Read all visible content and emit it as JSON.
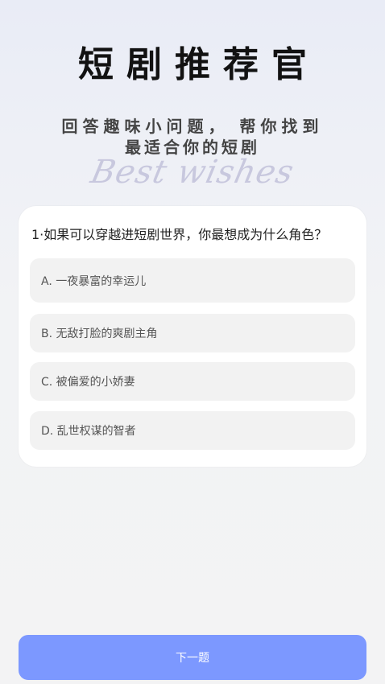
{
  "header": {
    "title": "短剧推荐官",
    "subtitle_line1": "回答趣味小问题， 帮你找到",
    "subtitle_line2": "最适合你的短剧",
    "script_text": "Best wishes"
  },
  "quiz": {
    "question": "1·如果可以穿越进短剧世界，你最想成为什么角色？",
    "options": [
      {
        "label": "A. 一夜暴富的幸运儿"
      },
      {
        "label": "B. 无敌打脸的爽剧主角"
      },
      {
        "label": "C. 被偏爱的小娇妻"
      },
      {
        "label": "D. 乱世权谋的智者"
      }
    ]
  },
  "footer": {
    "next_label": "下一题"
  }
}
